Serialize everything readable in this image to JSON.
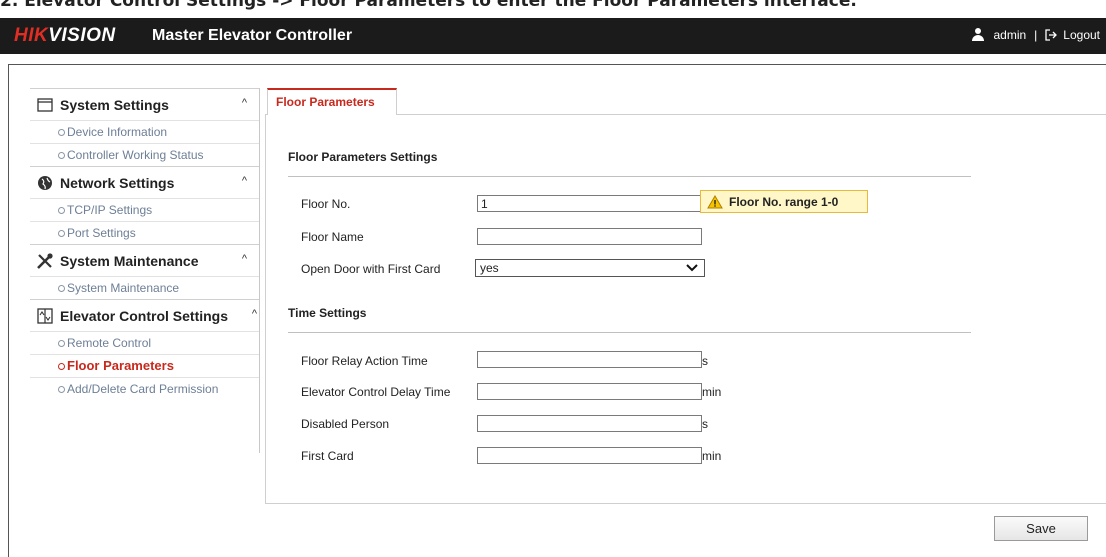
{
  "caption": "2. Elevator Control Settings -> Floor Parameters to enter the Floor Parameters interface.",
  "header": {
    "logo_hik": "HIK",
    "logo_vision": "VISION",
    "title": "Master Elevator Controller",
    "user": "admin",
    "separator": "|",
    "logout": "Logout"
  },
  "sidebar": {
    "groups": [
      {
        "label": "System Settings",
        "icon": "window-icon",
        "items": [
          "Device Information",
          "Controller Working Status"
        ]
      },
      {
        "label": "Network Settings",
        "icon": "globe-icon",
        "items": [
          "TCP/IP Settings",
          "Port Settings"
        ]
      },
      {
        "label": "System Maintenance",
        "icon": "tools-icon",
        "items": [
          "System Maintenance"
        ]
      },
      {
        "label": "Elevator Control Settings",
        "icon": "elevator-icon",
        "items": [
          "Remote Control",
          "Floor Parameters",
          "Add/Delete Card Permission"
        ]
      }
    ],
    "active_item": "Floor Parameters"
  },
  "tab": {
    "label": "Floor Parameters"
  },
  "floor_section": {
    "title": "Floor Parameters Settings",
    "floor_no_label": "Floor No.",
    "floor_no_value": "1",
    "floor_name_label": "Floor Name",
    "floor_name_value": "",
    "open_door_label": "Open Door with First Card",
    "open_door_value": "yes",
    "warning": "Floor No. range 1-0"
  },
  "time_section": {
    "title": "Time Settings",
    "fields": [
      {
        "label": "Floor Relay Action Time",
        "value": "",
        "unit": "s"
      },
      {
        "label": "Elevator Control Delay Time",
        "value": "",
        "unit": "min"
      },
      {
        "label": "Disabled Person",
        "value": "",
        "unit": "s"
      },
      {
        "label": "First Card",
        "value": "",
        "unit": "min"
      }
    ]
  },
  "save_label": "Save",
  "colors": {
    "accent": "#c8291d",
    "header_bg": "#1b1b1b",
    "warning_bg": "#fff7c8"
  }
}
